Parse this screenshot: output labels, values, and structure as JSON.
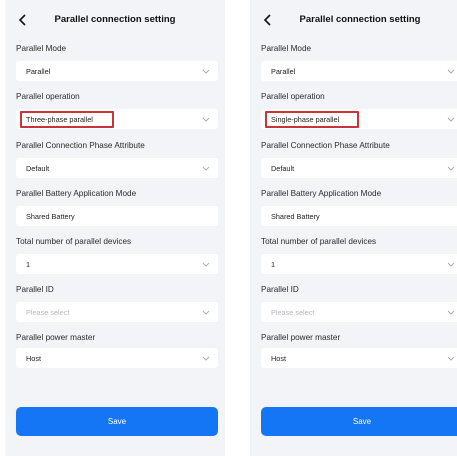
{
  "colors": {
    "accent": "#1476f4",
    "highlight": "#c8343a",
    "panel_bg": "#f3f4f8"
  },
  "icons": {
    "back": "chevron-left-icon",
    "dropdown": "chevron-down-icon"
  },
  "screens": [
    {
      "title": "Parallel connection setting",
      "fields": [
        {
          "label": "Parallel Mode",
          "value": "Parallel"
        },
        {
          "label": "Parallel operation",
          "value": "Three-phase parallel",
          "highlighted": true
        },
        {
          "label": "Parallel Connection Phase Attribute",
          "value": "Default"
        },
        {
          "label": "Parallel Battery Application Mode",
          "value": "Shared Battery"
        },
        {
          "label": "Total number of parallel devices",
          "value": "1"
        },
        {
          "label": "Parallel ID",
          "placeholder": "Please select"
        },
        {
          "label": "Parallel power master",
          "value": "Host"
        }
      ],
      "save_label": "Save"
    },
    {
      "title": "Parallel connection setting",
      "fields": [
        {
          "label": "Parallel Mode",
          "value": "Parallel"
        },
        {
          "label": "Parallel operation",
          "value": "Single-phase parallel",
          "highlighted": true
        },
        {
          "label": "Parallel Connection Phase Attribute",
          "value": "Default"
        },
        {
          "label": "Parallel Battery Application Mode",
          "value": "Shared Battery"
        },
        {
          "label": "Total number of parallel devices",
          "value": "1"
        },
        {
          "label": "Parallel ID",
          "placeholder": "Please select"
        },
        {
          "label": "Parallel power master",
          "value": "Host"
        }
      ],
      "save_label": "Save"
    }
  ]
}
